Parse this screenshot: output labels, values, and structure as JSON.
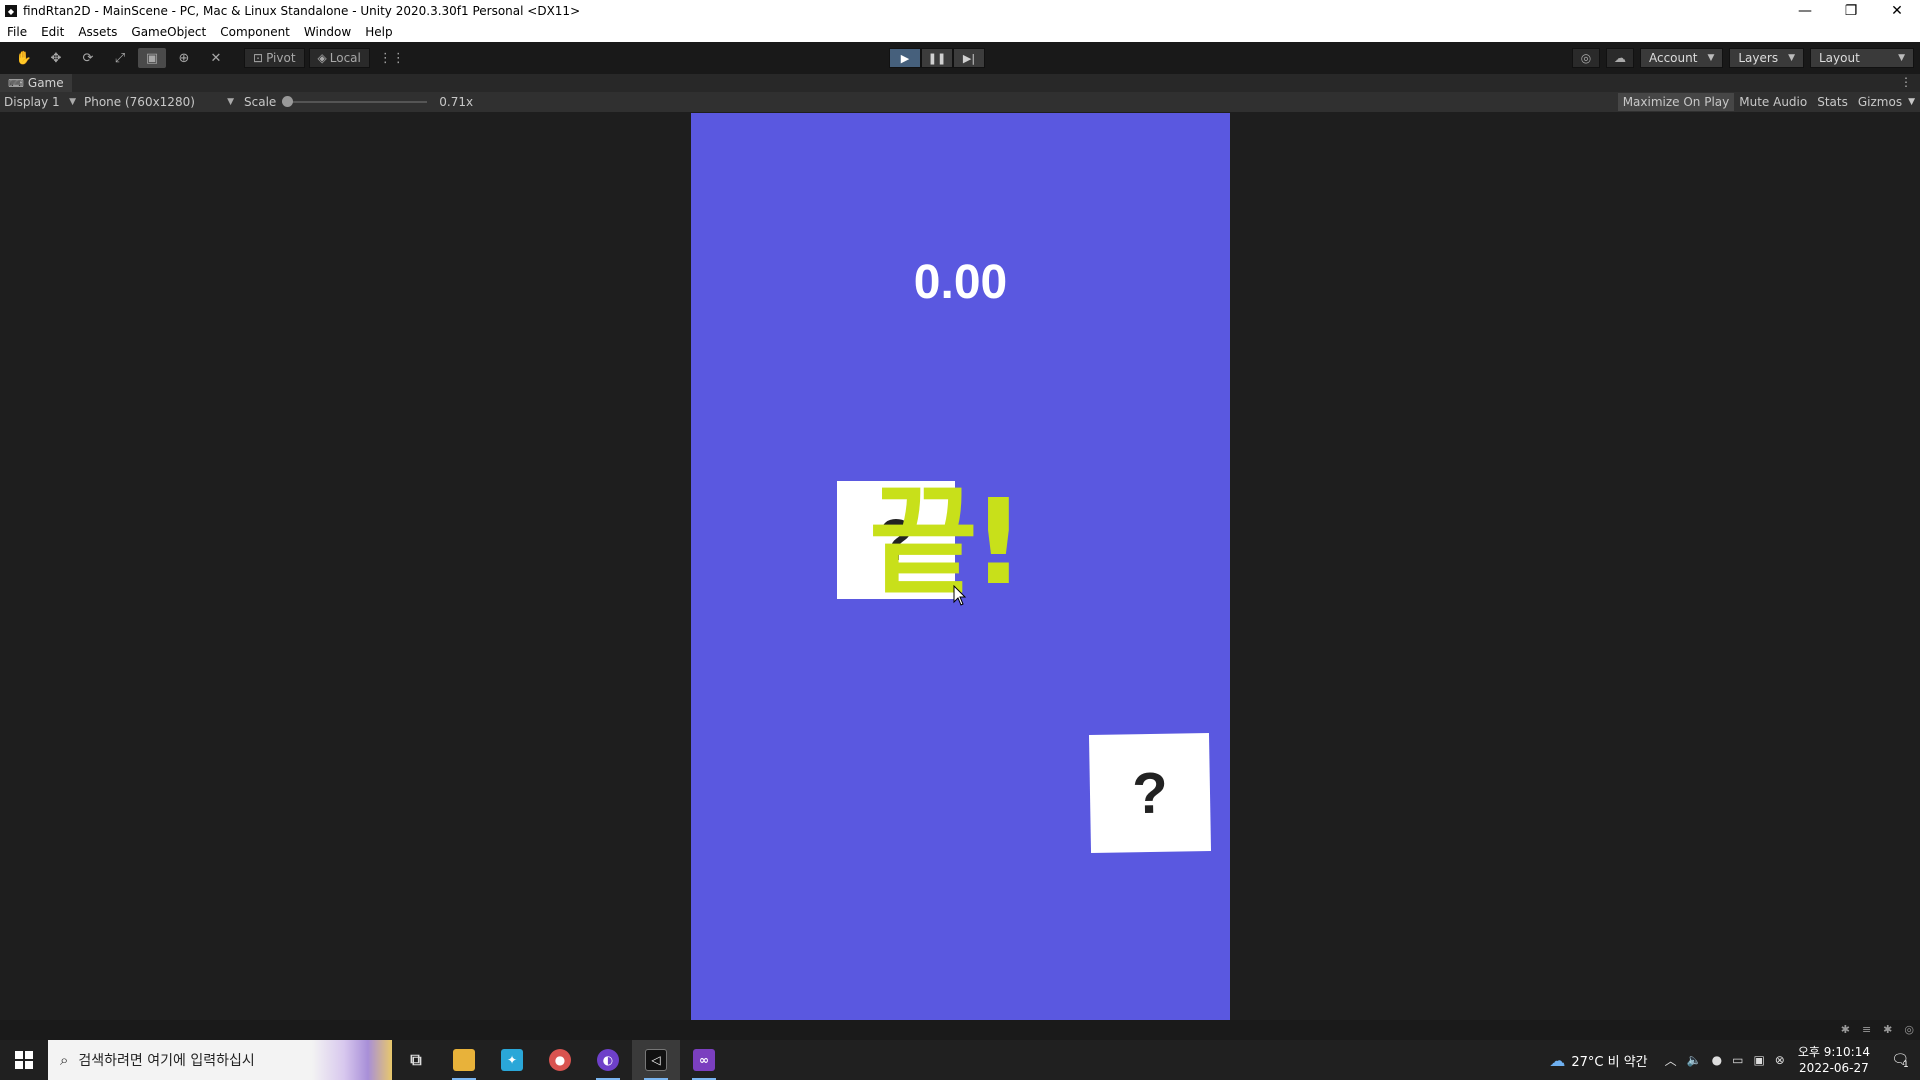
{
  "window": {
    "title": "findRtan2D - MainScene - PC, Mac & Linux Standalone - Unity 2020.3.30f1 Personal <DX11>",
    "minimize_glyph": "—",
    "maximize_glyph": "❐",
    "close_glyph": "✕"
  },
  "menu": [
    "File",
    "Edit",
    "Assets",
    "GameObject",
    "Component",
    "Window",
    "Help"
  ],
  "toolbar": {
    "pivot_label": "Pivot",
    "local_label": "Local",
    "account_label": "Account",
    "layers_label": "Layers",
    "layout_label": "Layout",
    "play_state": "playing"
  },
  "tab": {
    "label": "Game"
  },
  "game_view_bar": {
    "display": "Display 1",
    "resolution": "Phone (760x1280)",
    "scale_label": "Scale",
    "scale_value": "0.71x",
    "maximize_on_play": "Maximize On Play",
    "mute_audio": "Mute Audio",
    "stats": "Stats",
    "gizmos": "Gizmos"
  },
  "game": {
    "background_color": "#5a58e0",
    "timer": "0.00",
    "end_text": "끝!",
    "end_text_color": "#c8e01a",
    "cards": [
      {
        "label": "?"
      },
      {
        "label": "?"
      }
    ]
  },
  "taskbar": {
    "search_placeholder": "검색하려면 여기에 입력하십시",
    "weather": "27°C 비 약간",
    "time": "오후 9:10:14",
    "date": "2022-06-27",
    "notification_count": "1"
  }
}
